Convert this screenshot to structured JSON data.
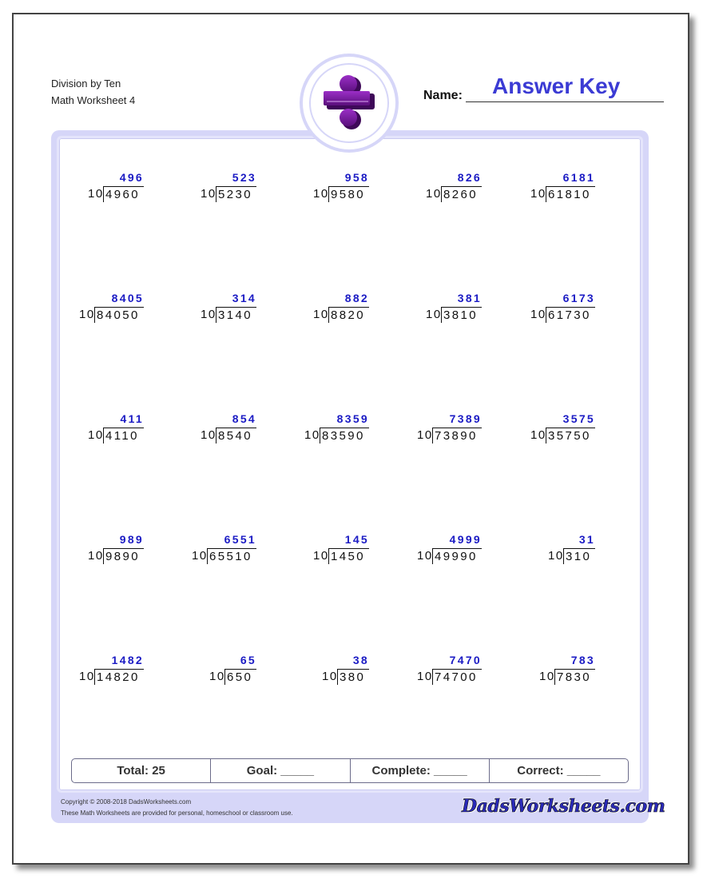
{
  "header": {
    "title": "Division by Ten",
    "subtitle": "Math Worksheet 4",
    "name_label": "Name:",
    "name_value": "Answer Key",
    "logo_icon": "division-sign-icon"
  },
  "colors": {
    "answer": "#1b1bc4",
    "answer_key": "#3b3bd4",
    "frame": "#d6d6f8",
    "logo_purple": "#7a1aa0"
  },
  "problems": [
    {
      "divisor": "10",
      "dividend": "4960",
      "quotient": "496"
    },
    {
      "divisor": "10",
      "dividend": "5230",
      "quotient": "523"
    },
    {
      "divisor": "10",
      "dividend": "9580",
      "quotient": "958"
    },
    {
      "divisor": "10",
      "dividend": "8260",
      "quotient": "826"
    },
    {
      "divisor": "10",
      "dividend": "61810",
      "quotient": "6181"
    },
    {
      "divisor": "10",
      "dividend": "84050",
      "quotient": "8405"
    },
    {
      "divisor": "10",
      "dividend": "3140",
      "quotient": "314"
    },
    {
      "divisor": "10",
      "dividend": "8820",
      "quotient": "882"
    },
    {
      "divisor": "10",
      "dividend": "3810",
      "quotient": "381"
    },
    {
      "divisor": "10",
      "dividend": "61730",
      "quotient": "6173"
    },
    {
      "divisor": "10",
      "dividend": "4110",
      "quotient": "411"
    },
    {
      "divisor": "10",
      "dividend": "8540",
      "quotient": "854"
    },
    {
      "divisor": "10",
      "dividend": "83590",
      "quotient": "8359"
    },
    {
      "divisor": "10",
      "dividend": "73890",
      "quotient": "7389"
    },
    {
      "divisor": "10",
      "dividend": "35750",
      "quotient": "3575"
    },
    {
      "divisor": "10",
      "dividend": "9890",
      "quotient": "989"
    },
    {
      "divisor": "10",
      "dividend": "65510",
      "quotient": "6551"
    },
    {
      "divisor": "10",
      "dividend": "1450",
      "quotient": "145"
    },
    {
      "divisor": "10",
      "dividend": "49990",
      "quotient": "4999"
    },
    {
      "divisor": "10",
      "dividend": "310",
      "quotient": "31"
    },
    {
      "divisor": "10",
      "dividend": "14820",
      "quotient": "1482"
    },
    {
      "divisor": "10",
      "dividend": "650",
      "quotient": "65"
    },
    {
      "divisor": "10",
      "dividend": "380",
      "quotient": "38"
    },
    {
      "divisor": "10",
      "dividend": "74700",
      "quotient": "7470"
    },
    {
      "divisor": "10",
      "dividend": "7830",
      "quotient": "783"
    }
  ],
  "score": {
    "total": "Total: 25",
    "goal": "Goal: _____",
    "complete": "Complete: _____",
    "correct": "Correct: _____"
  },
  "footer": {
    "copyright": "Copyright © 2008-2018 DadsWorksheets.com",
    "notice": "These Math Worksheets are provided for personal, homeschool or classroom use.",
    "brand": "DadsWorksheets.com"
  }
}
